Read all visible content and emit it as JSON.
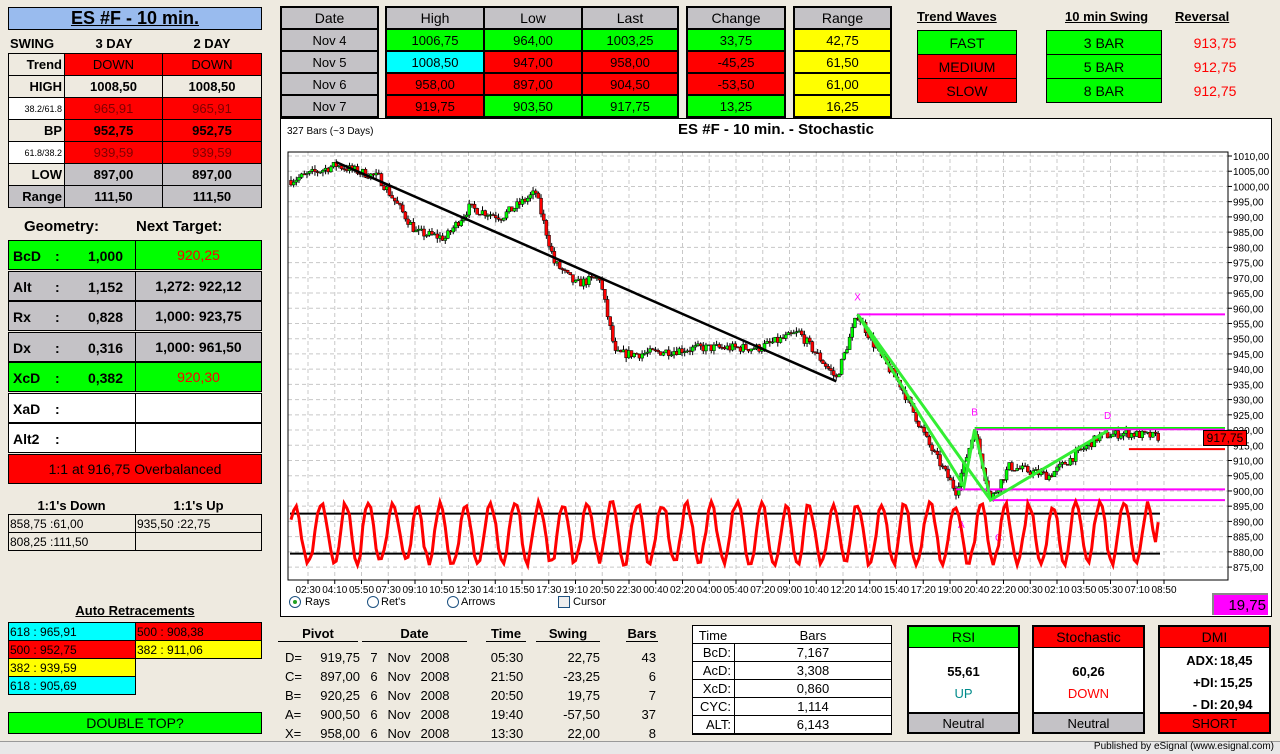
{
  "left": {
    "title": "ES #F - 10 min.",
    "swing_label": "SWING",
    "col1": "3 DAY",
    "col2": "2 DAY",
    "rows": [
      {
        "label": "Trend",
        "v1": "DOWN",
        "v2": "DOWN"
      },
      {
        "label": "HIGH",
        "v1": "1008,50",
        "v2": "1008,50"
      },
      {
        "label": "38.2/61.8",
        "v1": "965,91",
        "v2": "965,91"
      },
      {
        "label": "BP",
        "v1": "952,75",
        "v2": "952,75"
      },
      {
        "label": "61.8/38.2",
        "v1": "939,59",
        "v2": "939,59"
      },
      {
        "label": "LOW",
        "v1": "897,00",
        "v2": "897,00"
      },
      {
        "label": "Range",
        "v1": "111,50",
        "v2": "111,50"
      }
    ],
    "geometry_label": "Geometry:",
    "next_target_label": "Next Target:",
    "geometry": [
      {
        "name": "BcD",
        "sep": ":",
        "ratio": "1,000",
        "target": "920,25"
      },
      {
        "name": "Alt",
        "sep": ":",
        "ratio": "1,152",
        "target": "1,272: 922,12"
      },
      {
        "name": "Rx",
        "sep": ":",
        "ratio": "0,828",
        "target": "1,000: 923,75"
      },
      {
        "name": "Dx",
        "sep": ":",
        "ratio": "0,316",
        "target": "1,000: 961,50"
      },
      {
        "name": "XcD",
        "sep": ":",
        "ratio": "0,382",
        "target": "920,30"
      },
      {
        "name": "XaD",
        "sep": ":",
        "ratio": "",
        "target": ""
      },
      {
        "name": "Alt2",
        "sep": ":",
        "ratio": "",
        "target": ""
      }
    ],
    "overbalanced": "1:1 at 916,75 Overbalanced",
    "down_label": "1:1's Down",
    "up_label": "1:1's Up",
    "down": [
      "858,75 :61,00",
      "808,25 :111,50"
    ],
    "up": [
      "935,50 :22,75",
      ""
    ],
    "retr_title": "Auto Retracements",
    "retr_left": [
      "618 : 965,91",
      "500 : 952,75",
      "382 : 939,59",
      "618 : 905,69"
    ],
    "retr_right": [
      "500 : 908,38",
      "382 : 911,06"
    ],
    "pattern": "DOUBLE TOP?"
  },
  "daily": {
    "headers": {
      "date": "Date",
      "high": "High",
      "low": "Low",
      "last": "Last",
      "change": "Change",
      "range": "Range"
    },
    "rows": [
      {
        "date": "Nov  4",
        "high": "1006,75",
        "low": "964,00",
        "last": "1003,25",
        "change": "33,75",
        "range": "42,75"
      },
      {
        "date": "Nov  5",
        "high": "1008,50",
        "low": "947,00",
        "last": "958,00",
        "change": "-45,25",
        "range": "61,50"
      },
      {
        "date": "Nov  6",
        "high": "958,00",
        "low": "897,00",
        "last": "904,50",
        "change": "-53,50",
        "range": "61,00"
      },
      {
        "date": "Nov  7",
        "high": "919,75",
        "low": "903,50",
        "last": "917,75",
        "change": "13,25",
        "range": "16,25"
      }
    ]
  },
  "trend": {
    "waves_title": "Trend Waves",
    "swing_title": "10 min Swing",
    "reversal_title": "Reversal",
    "waves": [
      "FAST",
      "MEDIUM",
      "SLOW"
    ],
    "swing": [
      "3 BAR",
      "5 BAR",
      "8 BAR"
    ],
    "reversal": [
      "913,75",
      "912,75",
      "912,75"
    ]
  },
  "chart": {
    "bars_label": "327 Bars (~3 Days)",
    "title": "ES #F - 10 min. - Stochastic",
    "last_price": "917,75",
    "stoch_box": "19,75",
    "pivot_labels": [
      "X",
      "A",
      "B",
      "C",
      "D"
    ],
    "options": {
      "rays": "Rays",
      "rets": "Ret's",
      "arrows": "Arrows",
      "cursor": "Cursor"
    }
  },
  "chart_data": {
    "type": "candlestick",
    "title": "ES #F - 10 min. - Stochastic",
    "bars": 327,
    "ylim": [
      873,
      1012
    ],
    "y_ticks": [
      "1010,00",
      "1005,00",
      "1000,00",
      "995,00",
      "990,00",
      "985,00",
      "980,00",
      "975,00",
      "970,00",
      "965,00",
      "960,00",
      "955,00",
      "950,00",
      "945,00",
      "940,00",
      "935,00",
      "930,00",
      "925,00",
      "920,00",
      "915,00",
      "910,00",
      "905,00",
      "900,00",
      "895,00",
      "890,00",
      "885,00",
      "880,00",
      "875,00"
    ],
    "x_ticks": [
      "02:30",
      "04:10",
      "05:50",
      "07:30",
      "09:10",
      "10:50",
      "12:30",
      "14:10",
      "15:50",
      "17:30",
      "19:10",
      "20:50",
      "22:30",
      "00:40",
      "02:20",
      "04:00",
      "05:40",
      "07:20",
      "09:00",
      "10:40",
      "12:20",
      "14:00",
      "15:40",
      "17:20",
      "19:00",
      "20:40",
      "22:20",
      "00:30",
      "02:10",
      "03:50",
      "05:30",
      "07:10",
      "08:50"
    ],
    "price_path": [
      [
        0,
        1002
      ],
      [
        17,
        1007
      ],
      [
        33,
        1003
      ],
      [
        47,
        985
      ],
      [
        58,
        983
      ],
      [
        67,
        993
      ],
      [
        79,
        990
      ],
      [
        92,
        998
      ],
      [
        99,
        975
      ],
      [
        107,
        968
      ],
      [
        116,
        970
      ],
      [
        122,
        945
      ],
      [
        131,
        945
      ],
      [
        154,
        947
      ],
      [
        176,
        947
      ],
      [
        191,
        952
      ],
      [
        205,
        937
      ],
      [
        213,
        958
      ],
      [
        221,
        945
      ],
      [
        229,
        935
      ],
      [
        240,
        915
      ],
      [
        250,
        900
      ],
      [
        257,
        920
      ],
      [
        263,
        897
      ],
      [
        270,
        908
      ],
      [
        285,
        905
      ],
      [
        304,
        918
      ],
      [
        314,
        919
      ],
      [
        326,
        917.75
      ]
    ],
    "trendline": [
      [
        17,
        1008
      ],
      [
        205,
        936
      ]
    ],
    "pattern_xabcd": [
      [
        213,
        958
      ],
      [
        250,
        900.5
      ],
      [
        257,
        920.25
      ],
      [
        263,
        897
      ],
      [
        307,
        919.75
      ]
    ],
    "levels": [
      {
        "price": 958,
        "color": "#ff00ff"
      },
      {
        "price": 920.25,
        "color": "#ff00ff"
      },
      {
        "price": 900.5,
        "color": "#ff00ff"
      },
      {
        "price": 897,
        "color": "#ff00ff"
      },
      {
        "price": 913.75,
        "color": "#ff0000"
      }
    ],
    "stochastic": {
      "overbought": 80,
      "oversold": 20,
      "last": 19.75,
      "color": "#ff0000"
    }
  },
  "pivots": {
    "headers": {
      "pivot": "Pivot",
      "date": "Date",
      "time": "Time",
      "swing": "Swing",
      "bars": "Bars"
    },
    "rows": [
      {
        "name": "D=",
        "price": "919,75",
        "day": "7",
        "mon": "Nov",
        "year": "2008",
        "time": "05:30",
        "swing": "22,75",
        "bars": "43"
      },
      {
        "name": "C=",
        "price": "897,00",
        "day": "6",
        "mon": "Nov",
        "year": "2008",
        "time": "21:50",
        "swing": "-23,25",
        "bars": "6"
      },
      {
        "name": "B=",
        "price": "920,25",
        "day": "6",
        "mon": "Nov",
        "year": "2008",
        "time": "20:50",
        "swing": "19,75",
        "bars": "7"
      },
      {
        "name": "A=",
        "price": "900,50",
        "day": "6",
        "mon": "Nov",
        "year": "2008",
        "time": "19:40",
        "swing": "-57,50",
        "bars": "37"
      },
      {
        "name": "X=",
        "price": "958,00",
        "day": "6",
        "mon": "Nov",
        "year": "2008",
        "time": "13:30",
        "swing": "22,00",
        "bars": "8"
      }
    ]
  },
  "timebars": {
    "h1": "Time",
    "h2": "Bars",
    "rows": [
      {
        "k": "BcD:",
        "v": "7,167"
      },
      {
        "k": "AcD:",
        "v": "3,308"
      },
      {
        "k": "XcD:",
        "v": "0,860"
      },
      {
        "k": "CYC:",
        "v": "1,114"
      },
      {
        "k": "ALT:",
        "v": "6,143"
      }
    ]
  },
  "indicators": {
    "rsi": {
      "title": "RSI",
      "value": "55,61",
      "dir": "UP",
      "status": "Neutral"
    },
    "stoch": {
      "title": "Stochastic",
      "value": "60,26",
      "dir": "DOWN",
      "status": "Neutral"
    },
    "dmi": {
      "title": "DMI",
      "adx_label": "ADX:",
      "adx": "18,45",
      "pdi_label": "+DI:",
      "pdi": "15,25",
      "mdi_label": "- DI:",
      "mdi": "20,94",
      "status": "SHORT"
    }
  },
  "footer": "Published by eSignal (www.esignal.com)"
}
